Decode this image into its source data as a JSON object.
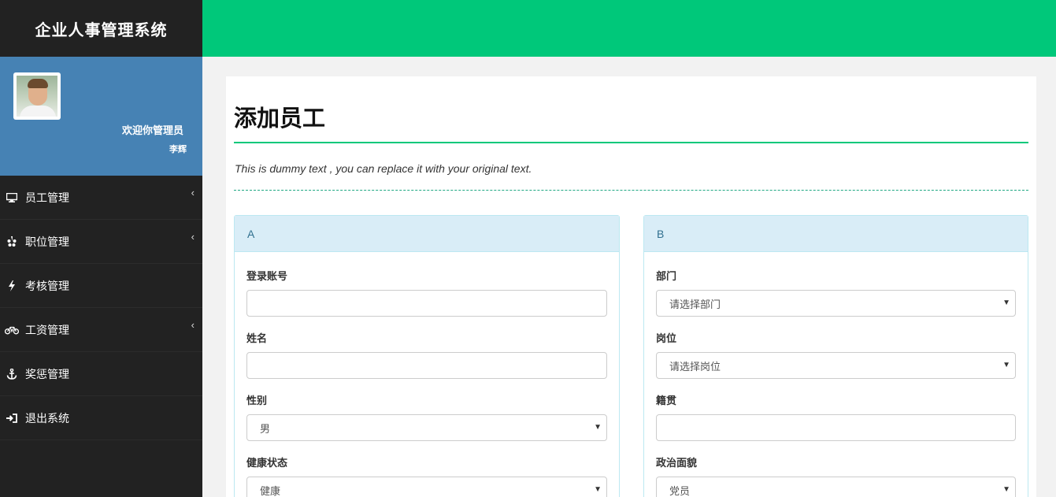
{
  "app": {
    "title": "企业人事管理系统"
  },
  "user": {
    "welcome": "欢迎你管理员",
    "name": "李辉"
  },
  "menu": [
    {
      "label": "员工管理",
      "icon": "monitor-icon",
      "has_children": true
    },
    {
      "label": "职位管理",
      "icon": "yelp-icon",
      "has_children": true
    },
    {
      "label": "考核管理",
      "icon": "bolt-icon",
      "has_children": false
    },
    {
      "label": "工资管理",
      "icon": "bicycle-icon",
      "has_children": true
    },
    {
      "label": "奖惩管理",
      "icon": "anchor-icon",
      "has_children": false
    },
    {
      "label": "退出系统",
      "icon": "sign-in-icon",
      "has_children": false
    }
  ],
  "page": {
    "title": "添加员工",
    "subtitle": "This is dummy text , you can replace it with your original text."
  },
  "panel_a": {
    "heading": "A",
    "fields": [
      {
        "label": "登录账号",
        "type": "text",
        "value": ""
      },
      {
        "label": "姓名",
        "type": "text",
        "value": ""
      },
      {
        "label": "性别",
        "type": "select",
        "value": "男"
      },
      {
        "label": "健康状态",
        "type": "select",
        "value": "健康"
      }
    ]
  },
  "panel_b": {
    "heading": "B",
    "fields": [
      {
        "label": "部门",
        "type": "select",
        "value": "请选择部门"
      },
      {
        "label": "岗位",
        "type": "select",
        "value": "请选择岗位"
      },
      {
        "label": "籍贯",
        "type": "text",
        "value": ""
      },
      {
        "label": "政治面貌",
        "type": "select",
        "value": "党员"
      }
    ]
  },
  "colors": {
    "accent": "#00c87a",
    "sidebar": "#222222",
    "user_panel": "#4682b4",
    "panel_head": "#d9edf7"
  }
}
